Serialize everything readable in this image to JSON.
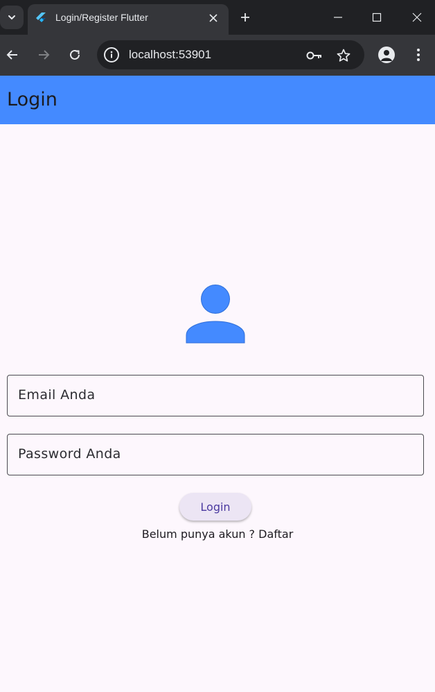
{
  "browser": {
    "tab_title": "Login/Register Flutter",
    "url": "localhost:53901",
    "icons": {
      "tab_search": "chevron-down-icon",
      "favicon": "flutter-logo-icon",
      "tab_close": "close-icon",
      "new_tab": "plus-icon",
      "minimize": "minimize-icon",
      "maximize": "maximize-icon",
      "close_window": "close-icon",
      "back": "arrow-left-icon",
      "forward": "arrow-right-icon",
      "reload": "reload-icon",
      "site_info": "info-icon",
      "password_key": "key-icon",
      "bookmark": "star-icon",
      "profile": "account-icon",
      "menu": "more-vert-icon"
    }
  },
  "app": {
    "title": "Login",
    "accent_color": "#448aff",
    "email_placeholder": "Email Anda",
    "password_placeholder": "Password Anda",
    "login_button": "Login",
    "register_prompt": "Belum punya akun ? Daftar",
    "avatar_icon": "person-icon"
  }
}
